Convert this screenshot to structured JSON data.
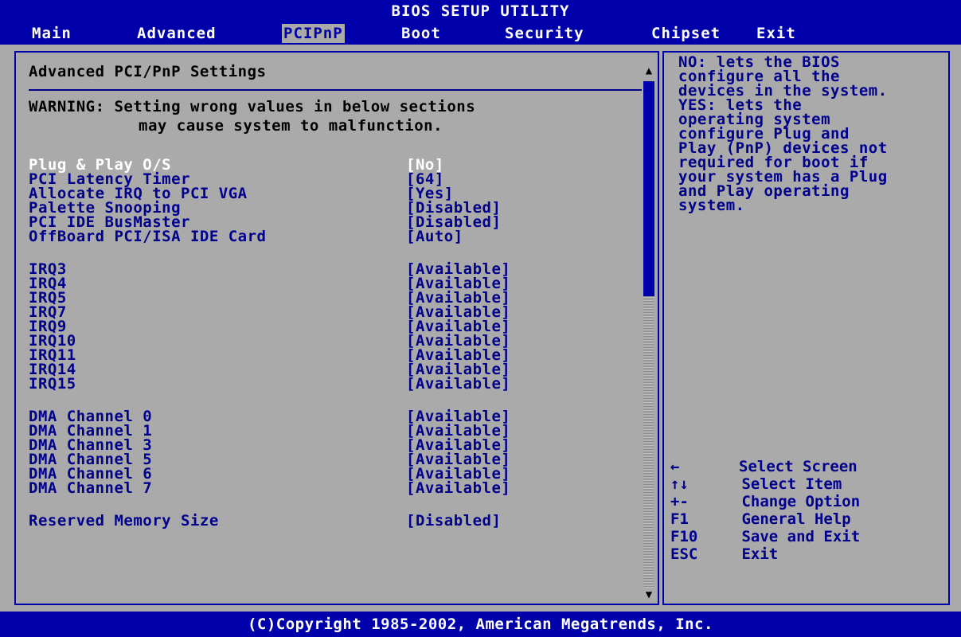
{
  "header": {
    "title": "BIOS SETUP UTILITY",
    "tabs": [
      "Main",
      "Advanced",
      "PCIPnP",
      "Boot",
      "Security",
      "Chipset",
      "Exit"
    ],
    "active_tab": "PCIPnP"
  },
  "main": {
    "title": "Advanced PCI/PnP Settings",
    "warning_line1": "WARNING: Setting wrong values in below sections",
    "warning_line2": "may cause system to malfunction.",
    "settings": [
      {
        "label": "Plug & Play O/S",
        "value": "[No]"
      },
      {
        "label": "PCI Latency Timer",
        "value": "[64]"
      },
      {
        "label": "Allocate IRQ to PCI VGA",
        "value": "[Yes]"
      },
      {
        "label": "Palette Snooping",
        "value": "[Disabled]"
      },
      {
        "label": "PCI IDE BusMaster",
        "value": "[Disabled]"
      },
      {
        "label": "OffBoard PCI/ISA IDE Card",
        "value": "[Auto]"
      }
    ],
    "irqs": [
      {
        "label": "IRQ3",
        "value": "[Available]"
      },
      {
        "label": "IRQ4",
        "value": "[Available]"
      },
      {
        "label": "IRQ5",
        "value": "[Available]"
      },
      {
        "label": "IRQ7",
        "value": "[Available]"
      },
      {
        "label": "IRQ9",
        "value": "[Available]"
      },
      {
        "label": "IRQ10",
        "value": "[Available]"
      },
      {
        "label": "IRQ11",
        "value": "[Available]"
      },
      {
        "label": "IRQ14",
        "value": "[Available]"
      },
      {
        "label": "IRQ15",
        "value": "[Available]"
      }
    ],
    "dma": [
      {
        "label": "DMA Channel 0",
        "value": "[Available]"
      },
      {
        "label": "DMA Channel 1",
        "value": "[Available]"
      },
      {
        "label": "DMA Channel 3",
        "value": "[Available]"
      },
      {
        "label": "DMA Channel 5",
        "value": "[Available]"
      },
      {
        "label": "DMA Channel 6",
        "value": "[Available]"
      },
      {
        "label": "DMA Channel 7",
        "value": "[Available]"
      }
    ],
    "reserved": {
      "label": "Reserved Memory Size",
      "value": "[Disabled]"
    }
  },
  "help": {
    "lines": [
      "NO: lets the BIOS",
      "configure all the",
      "devices in the system.",
      "YES: lets the",
      "operating system",
      "configure Plug and",
      "Play (PnP) devices not",
      "required for boot if",
      "your system has a Plug",
      "and Play operating",
      "system."
    ],
    "keys": [
      {
        "key": "←",
        "desc": "Select Screen"
      },
      {
        "key": "↑↓",
        "desc": " Select Item"
      },
      {
        "key": "+-",
        "desc": " Change Option"
      },
      {
        "key": "F1",
        "desc": " General Help"
      },
      {
        "key": "F10",
        "desc": " Save and Exit"
      },
      {
        "key": "ESC",
        "desc": " Exit"
      }
    ]
  },
  "footer": {
    "copyright": "(C)Copyright 1985-2002, American Megatrends, Inc."
  },
  "colors": {
    "background": "#0000aa",
    "panel": "#aaaaaa",
    "text": "#00008c",
    "selected": "#ffffff"
  }
}
